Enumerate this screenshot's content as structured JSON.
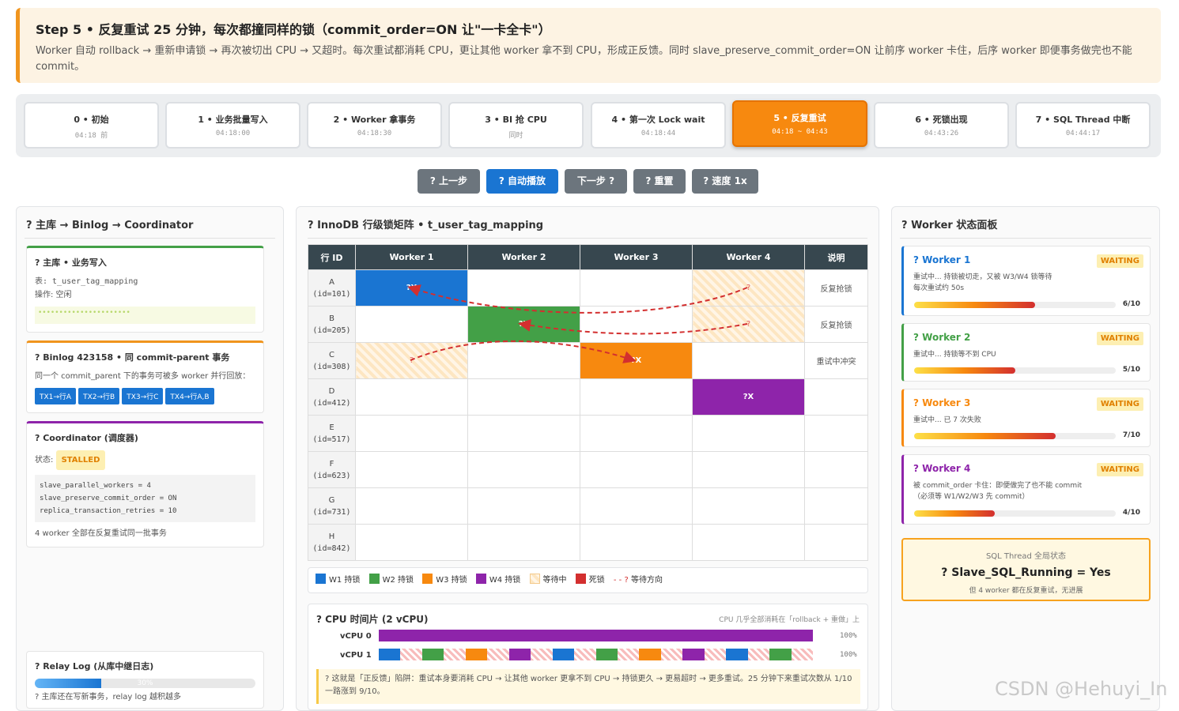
{
  "banner": {
    "title": "Step 5 • 反复重试 25 分钟，每次都撞同样的锁（commit_order=ON 让\"一卡全卡\"）",
    "desc": "Worker 自动 rollback → 重新申请锁 → 再次被切出 CPU → 又超时。每次重试都消耗 CPU，更让其他 worker 拿不到 CPU，形成正反馈。同时 slave_preserve_commit_order=ON 让前序 worker 卡住，后序 worker 即便事务做完也不能commit。"
  },
  "steps": [
    {
      "label": "0 • 初始",
      "time": "04:18 前"
    },
    {
      "label": "1 • 业务批量写入",
      "time": "04:18:00"
    },
    {
      "label": "2 • Worker 拿事务",
      "time": "04:18:30"
    },
    {
      "label": "3 • BI 抢 CPU",
      "time": "同时"
    },
    {
      "label": "4 • 第一次 Lock wait",
      "time": "04:18:44"
    },
    {
      "label": "5 • 反复重试",
      "time": "04:18 ~ 04:43"
    },
    {
      "label": "6 • 死锁出现",
      "time": "04:43:26"
    },
    {
      "label": "7 • SQL Thread 中断",
      "time": "04:44:17"
    }
  ],
  "active_step": 5,
  "controls": {
    "prev": "? 上一步",
    "auto": "? 自动播放",
    "next": "下一步 ?",
    "reset": "? 重置",
    "speed": "? 速度 1x"
  },
  "left": {
    "title": "? 主库 → Binlog → Coordinator",
    "master": {
      "title": "? 主库 • 业务写入",
      "table": "表: t_user_tag_mapping",
      "op": "操作: 空闲",
      "dots": "••••••••••••••••••••••"
    },
    "binlog": {
      "title": "? Binlog 423158 • 同 commit-parent 事务",
      "desc": "同一个 commit_parent 下的事务可被多 worker 并行回放：",
      "tags": [
        "TX1→行A",
        "TX2→行B",
        "TX3→行C",
        "TX4→行A,B"
      ]
    },
    "coord": {
      "title": "? Coordinator (调度器)",
      "state_label": "状态:",
      "state": "STALLED",
      "code": [
        "slave_parallel_workers = 4",
        "slave_preserve_commit_order = ON",
        "replica_transaction_retries = 10"
      ],
      "note": "4 worker 全部在反复重试同一批事务"
    },
    "relay": {
      "title": "? Relay Log (从库中继日志)",
      "pct_label": "30%",
      "pct": 0.3,
      "note": "? 主库还在写新事务，relay log 越积越多"
    }
  },
  "matrix": {
    "title": "? InnoDB 行级锁矩阵 • t_user_tag_mapping",
    "headers": [
      "行 ID",
      "Worker 1",
      "Worker 2",
      "Worker 3",
      "Worker 4",
      "说明"
    ],
    "rows": [
      {
        "id": "A",
        "pk": "(id=101)",
        "cells": [
          "?X",
          "",
          "",
          "?"
        ],
        "note": "反复抢锁"
      },
      {
        "id": "B",
        "pk": "(id=205)",
        "cells": [
          "",
          "?X",
          "",
          "?"
        ],
        "note": "反复抢锁"
      },
      {
        "id": "C",
        "pk": "(id=308)",
        "cells": [
          "?",
          "",
          "?X",
          ""
        ],
        "note": "重试中冲突"
      },
      {
        "id": "D",
        "pk": "(id=412)",
        "cells": [
          "",
          "",
          "",
          "?X"
        ],
        "note": ""
      },
      {
        "id": "E",
        "pk": "(id=517)",
        "cells": [
          "",
          "",
          "",
          ""
        ],
        "note": ""
      },
      {
        "id": "F",
        "pk": "(id=623)",
        "cells": [
          "",
          "",
          "",
          ""
        ],
        "note": ""
      },
      {
        "id": "G",
        "pk": "(id=731)",
        "cells": [
          "",
          "",
          "",
          ""
        ],
        "note": ""
      },
      {
        "id": "H",
        "pk": "(id=842)",
        "cells": [
          "",
          "",
          "",
          ""
        ],
        "note": ""
      }
    ],
    "legend": [
      "W1 持锁",
      "W2 持锁",
      "W3 持锁",
      "W4 持锁",
      "等待中",
      "死锁",
      "等待方向"
    ],
    "legend_arrow": "- - ?"
  },
  "cpu": {
    "title": "? CPU 时间片 (2 vCPU)",
    "hint": "CPU 几乎全部消耗在「rollback + 重做」上",
    "rows": [
      {
        "label": "vCPU 0",
        "pct": "100%"
      },
      {
        "label": "vCPU 1",
        "pct": "100%"
      }
    ],
    "note": "? 这就是「正反馈」陷阱：重试本身要消耗 CPU → 让其他 worker 更拿不到 CPU → 持锁更久 → 更易超时 → 更多重试。25 分钟下来重试次数从 1/10 一路涨到 9/10。"
  },
  "workers": {
    "title": "? Worker 状态面板",
    "items": [
      {
        "name": "? Worker 1",
        "status": "WAITING",
        "desc": "重试中... 持锁被切走，又被 W3/W4 锁等待\n每次重试约 50s",
        "count": "6/10",
        "ratio": 0.6,
        "color": "#1a75d2"
      },
      {
        "name": "? Worker 2",
        "status": "WAITING",
        "desc": "重试中... 持锁等不到 CPU",
        "count": "5/10",
        "ratio": 0.5,
        "color": "#43a047"
      },
      {
        "name": "? Worker 3",
        "status": "WAITING",
        "desc": "重试中... 已 7 次失败",
        "count": "7/10",
        "ratio": 0.7,
        "color": "#f7890f"
      },
      {
        "name": "? Worker 4",
        "status": "WAITING",
        "desc": "被 commit_order 卡住：即便做完了也不能 commit\n（必须等 W1/W2/W3 先 commit）",
        "count": "4/10",
        "ratio": 0.4,
        "color": "#8e24aa"
      }
    ],
    "sql": {
      "title": "SQL Thread 全局状态",
      "main": "? Slave_SQL_Running = Yes",
      "sub": "但 4 worker 都在反复重试，无进展"
    }
  },
  "watermark": "CSDN @Hehuyi_In"
}
